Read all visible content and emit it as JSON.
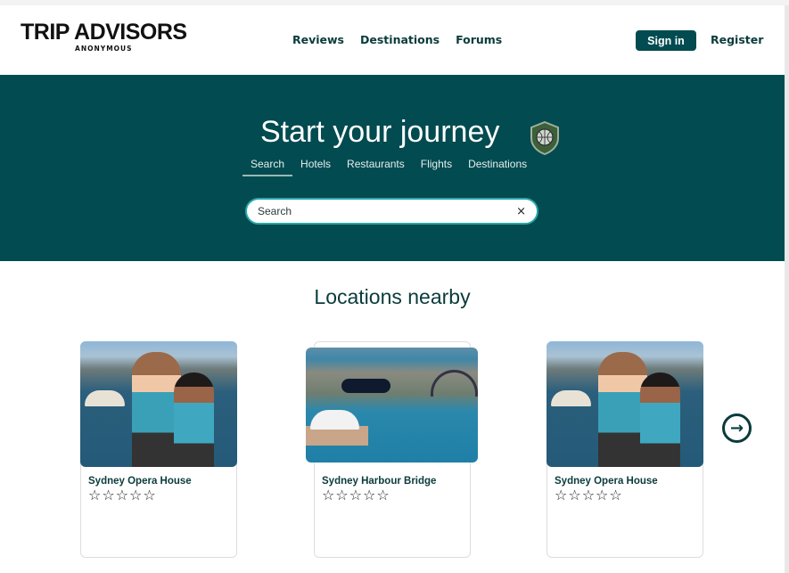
{
  "header": {
    "logo_title": "TRIP ADVISORS",
    "logo_subtitle": "ANONYMOUS",
    "nav": [
      "Reviews",
      "Destinations",
      "Forums"
    ],
    "sign_in": "Sign in",
    "register": "Register"
  },
  "hero": {
    "title": "Start your journey",
    "tabs": [
      "Search",
      "Hotels",
      "Restaurants",
      "Flights",
      "Destinations"
    ],
    "active_tab": "Search",
    "search_placeholder": "Search",
    "clear_icon": "×"
  },
  "section": {
    "title": "Locations nearby"
  },
  "cards": [
    {
      "name": "Sydney Opera House",
      "rating": 0,
      "stars": "☆☆☆☆☆"
    },
    {
      "name": "Sydney Harbour Bridge",
      "rating": 0,
      "stars": "☆☆☆☆☆"
    },
    {
      "name": "Sydney Opera House",
      "rating": 0,
      "stars": "☆☆☆☆☆"
    }
  ],
  "colors": {
    "brand": "#024b50",
    "accent": "#2aa7a9"
  }
}
